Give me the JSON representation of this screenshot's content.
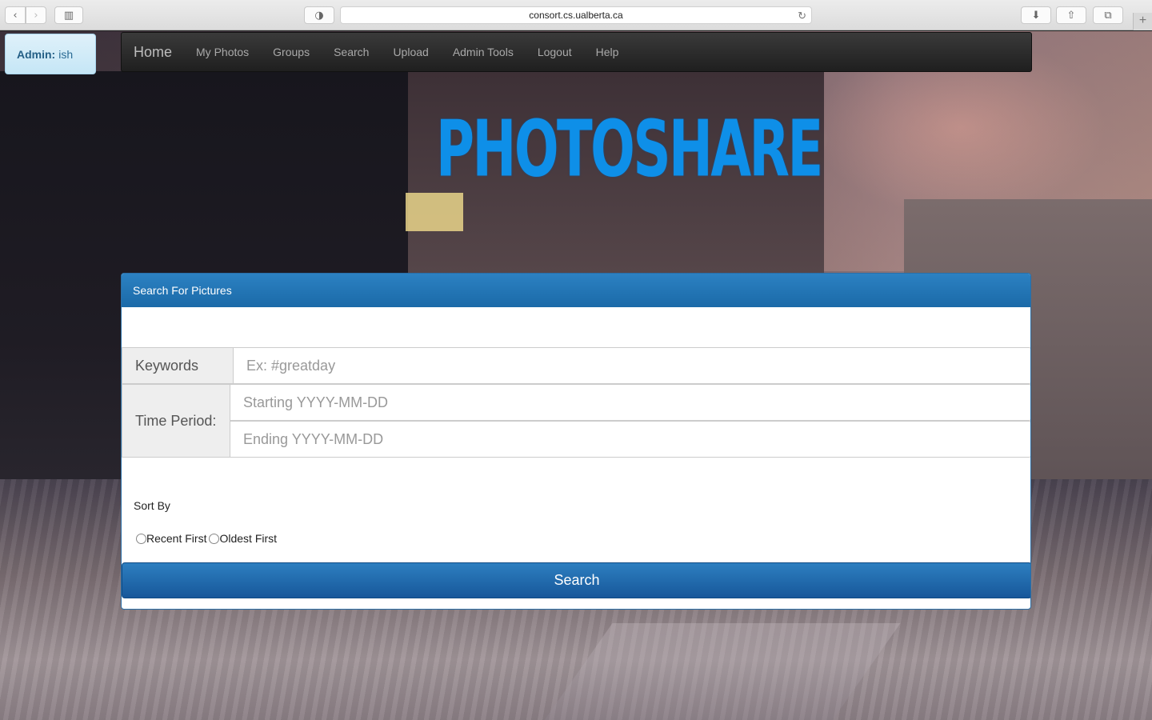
{
  "browser": {
    "url": "consort.cs.ualberta.ca"
  },
  "admin": {
    "label": "Admin:",
    "user": "ish"
  },
  "navbar": {
    "brand": "Home",
    "items": [
      "My Photos",
      "Groups",
      "Search",
      "Upload",
      "Admin Tools",
      "Logout",
      "Help"
    ]
  },
  "logo": {
    "text": "PHOTOSHARE"
  },
  "panel": {
    "heading": "Search For Pictures",
    "keywords": {
      "label": "Keywords",
      "placeholder": "Ex: #greatday"
    },
    "time_period": {
      "label": "Time Period:",
      "start_placeholder": "Starting YYYY-MM-DD",
      "end_placeholder": "Ending YYYY-MM-DD"
    },
    "sort": {
      "label": "Sort By",
      "options": [
        "Recent First",
        "Oldest First"
      ]
    },
    "search_button": "Search"
  },
  "colors": {
    "accent": "#1b6aa8",
    "logo": "#0e8fe8",
    "navbar": "#2a2a2a"
  }
}
